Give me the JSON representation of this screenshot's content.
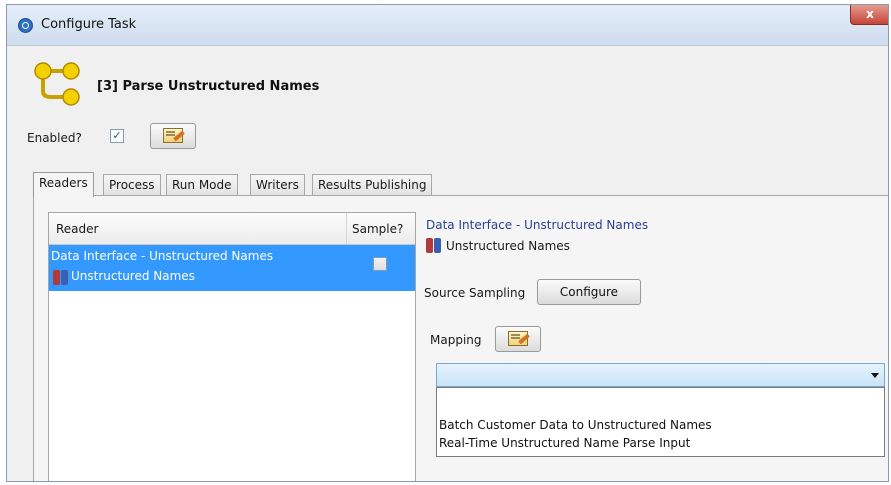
{
  "window": {
    "title": "Configure Task",
    "close_label": "x"
  },
  "task": {
    "title": "[3] Parse Unstructured Names"
  },
  "enabled": {
    "label": "Enabled?",
    "checked_mark": "✓"
  },
  "tabs": [
    {
      "label": "Readers",
      "active": true
    },
    {
      "label": "Process"
    },
    {
      "label": "Run Mode"
    },
    {
      "label": "Writers"
    },
    {
      "label": "Results Publishing"
    }
  ],
  "reader_table": {
    "columns": [
      "Reader",
      "Sample?"
    ],
    "rows": [
      {
        "interface": "Data Interface - Unstructured Names",
        "name": "Unstructured Names",
        "sample": false,
        "selected": true
      }
    ]
  },
  "details": {
    "interface": "Data Interface - Unstructured Names",
    "name": "Unstructured Names",
    "source_sampling_label": "Source Sampling",
    "configure_label": "Configure",
    "mapping_label": "Mapping"
  },
  "mapping_dropdown": {
    "selected": "",
    "options": [
      "Batch Customer Data to Unstructured Names",
      "Real-Time Unstructured Name Parse Input"
    ]
  },
  "colors": {
    "selection": "#3399ff",
    "link_text": "#2a3f8f",
    "combo": "#c9e3f7"
  }
}
